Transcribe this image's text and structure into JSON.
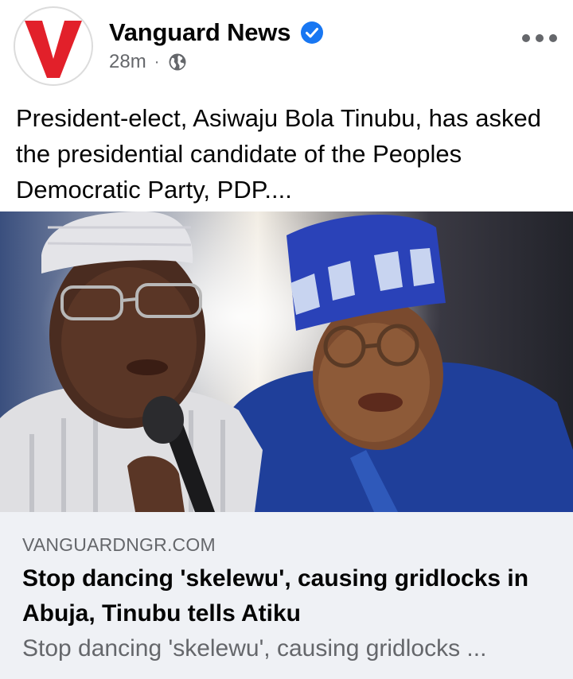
{
  "post": {
    "page_name": "Vanguard News",
    "timestamp": "28m",
    "separator": "·",
    "privacy_icon": "globe-icon",
    "verified_icon": "verified-badge-icon",
    "more_icon": "more-options-icon",
    "avatar_letter": "V",
    "text": "President-elect, Asiwaju Bola Tinubu, has asked the presidential candidate of the Peoples Democratic Party, PDP...."
  },
  "link_preview": {
    "domain": "VANGUARDNGR.COM",
    "title": "Stop dancing 'skelewu', causing gridlocks in Abuja, Tinubu tells Atiku",
    "description": "Stop dancing 'skelewu', causing gridlocks ..."
  },
  "colors": {
    "brand_red": "#e2202a",
    "verified_blue": "#1877f2",
    "secondary_text": "#65676b",
    "preview_bg": "#eff1f5"
  }
}
